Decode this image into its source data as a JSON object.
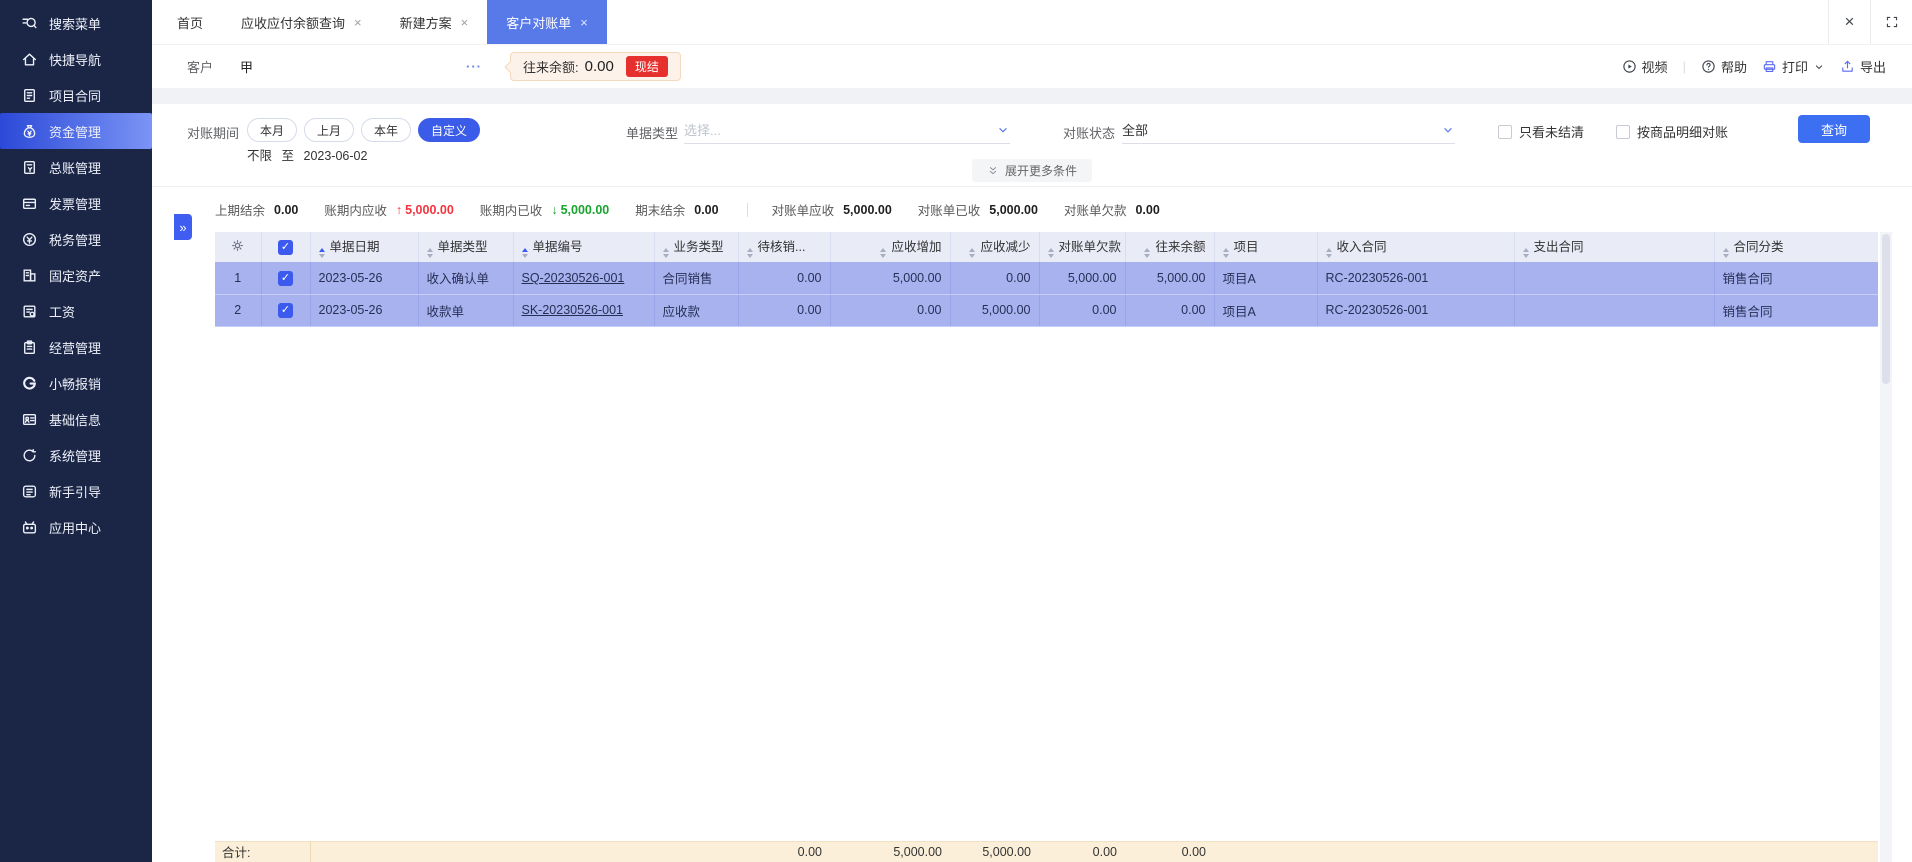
{
  "sidebar": {
    "items": [
      {
        "label": "搜索菜单",
        "icon": "search",
        "active": false
      },
      {
        "label": "快捷导航",
        "icon": "home",
        "active": false
      },
      {
        "label": "项目合同",
        "icon": "contract",
        "active": false
      },
      {
        "label": "资金管理",
        "icon": "funds",
        "active": true
      },
      {
        "label": "总账管理",
        "icon": "ledger",
        "active": false
      },
      {
        "label": "发票管理",
        "icon": "invoice",
        "active": false
      },
      {
        "label": "税务管理",
        "icon": "tax",
        "active": false
      },
      {
        "label": "固定资产",
        "icon": "assets",
        "active": false
      },
      {
        "label": "工资",
        "icon": "payroll",
        "active": false
      },
      {
        "label": "经营管理",
        "icon": "business",
        "active": false
      },
      {
        "label": "小畅报销",
        "icon": "reimburse",
        "active": false
      },
      {
        "label": "基础信息",
        "icon": "baseinfo",
        "active": false
      },
      {
        "label": "系统管理",
        "icon": "system",
        "active": false
      },
      {
        "label": "新手引导",
        "icon": "guide",
        "active": false
      },
      {
        "label": "应用中心",
        "icon": "appcenter",
        "active": false
      }
    ]
  },
  "tabs": {
    "items": [
      {
        "label": "首页",
        "closable": false,
        "active": false
      },
      {
        "label": "应收应付余额查询",
        "closable": true,
        "active": false
      },
      {
        "label": "新建方案",
        "closable": true,
        "active": false
      },
      {
        "label": "客户对账单",
        "closable": true,
        "active": true
      }
    ],
    "close_glyph": "×"
  },
  "toolbar": {
    "customer_label": "客户",
    "customer_value": "甲",
    "more": "···",
    "balance_label": "往来余额:",
    "balance_value": "0.00",
    "settle_badge": "现结",
    "video": "视频",
    "help": "帮助",
    "print": "打印",
    "export": "导出"
  },
  "filters": {
    "period_label": "对账期间",
    "period_options": [
      "本月",
      "上月",
      "本年",
      "自定义"
    ],
    "period_active": "自定义",
    "date_start": "不限",
    "date_joiner": "至",
    "date_end": "2023-06-02",
    "doc_type_label": "单据类型",
    "doc_type_placeholder": "选择...",
    "status_label": "对账状态",
    "status_value": "全部",
    "checkbox_unsettled": "只看未结清",
    "checkbox_by_item": "按商品明细对账",
    "query_button": "查询",
    "expand_more": "展开更多条件"
  },
  "summary": {
    "left": [
      {
        "label": "上期结余",
        "value": "0.00",
        "trend": "none"
      },
      {
        "label": "账期内应收",
        "value": "5,000.00",
        "trend": "up"
      },
      {
        "label": "账期内已收",
        "value": "5,000.00",
        "trend": "down"
      },
      {
        "label": "期末结余",
        "value": "0.00",
        "trend": "none"
      }
    ],
    "right": [
      {
        "label": "对账单应收",
        "value": "5,000.00"
      },
      {
        "label": "对账单已收",
        "value": "5,000.00"
      },
      {
        "label": "对账单欠款",
        "value": "0.00"
      }
    ],
    "up_glyph": "↑",
    "down_glyph": "↓"
  },
  "table": {
    "columns": [
      {
        "label": "",
        "key": "settings"
      },
      {
        "label": "",
        "key": "select"
      },
      {
        "label": "单据日期",
        "sorted": true
      },
      {
        "label": "单据类型",
        "sorted": false
      },
      {
        "label": "单据编号",
        "sorted": true
      },
      {
        "label": "业务类型",
        "sorted": false
      },
      {
        "label": "待核销...",
        "sorted": false
      },
      {
        "label": "应收增加",
        "sorted": false
      },
      {
        "label": "应收减少",
        "sorted": false
      },
      {
        "label": "对账单欠款",
        "sorted": false
      },
      {
        "label": "往来余额",
        "sorted": false
      },
      {
        "label": "项目",
        "sorted": false
      },
      {
        "label": "收入合同",
        "sorted": false
      },
      {
        "label": "支出合同",
        "sorted": false
      },
      {
        "label": "合同分类",
        "sorted": false
      }
    ],
    "rows": [
      {
        "index": "1",
        "checked": true,
        "date": "2023-05-26",
        "doc_type": "收入确认单",
        "doc_no": "SQ-20230526-001",
        "biz_type": "合同销售",
        "pending_writeoff": "0.00",
        "receivable_increase": "5,000.00",
        "receivable_decrease": "0.00",
        "statement_owing": "5,000.00",
        "balance": "5,000.00",
        "project": "项目A",
        "income_contract": "RC-20230526-001",
        "expense_contract": "",
        "contract_category": "销售合同"
      },
      {
        "index": "2",
        "checked": true,
        "date": "2023-05-26",
        "doc_type": "收款单",
        "doc_no": "SK-20230526-001",
        "biz_type": "应收款",
        "pending_writeoff": "0.00",
        "receivable_increase": "0.00",
        "receivable_decrease": "5,000.00",
        "statement_owing": "0.00",
        "balance": "0.00",
        "project": "项目A",
        "income_contract": "RC-20230526-001",
        "expense_contract": "",
        "contract_category": "销售合同"
      }
    ],
    "totals": {
      "label": "合计:",
      "pending_writeoff": "0.00",
      "receivable_increase": "5,000.00",
      "receivable_decrease": "5,000.00",
      "statement_owing": "0.00",
      "balance": "0.00"
    }
  },
  "icons": {
    "close-window-icon": "×",
    "fullscreen-icon": "corner brackets",
    "gear-icon": "gear",
    "check-icon": "✓",
    "chevron-down-icon": "v",
    "double-chevron-down-icon": "vv",
    "ellipsis-icon": "···"
  },
  "colors": {
    "sidebar_bg": "#1b2647",
    "active_tab": "#5879e8",
    "accent_blue": "#3d5bf0",
    "row_highlight": "#a8b2ef",
    "badge_red": "#e5302d",
    "trend_up_red": "#f5333f",
    "trend_down_green": "#18a42e",
    "totals_bg": "#fcefd9",
    "header_bg": "#e9ebf7"
  }
}
